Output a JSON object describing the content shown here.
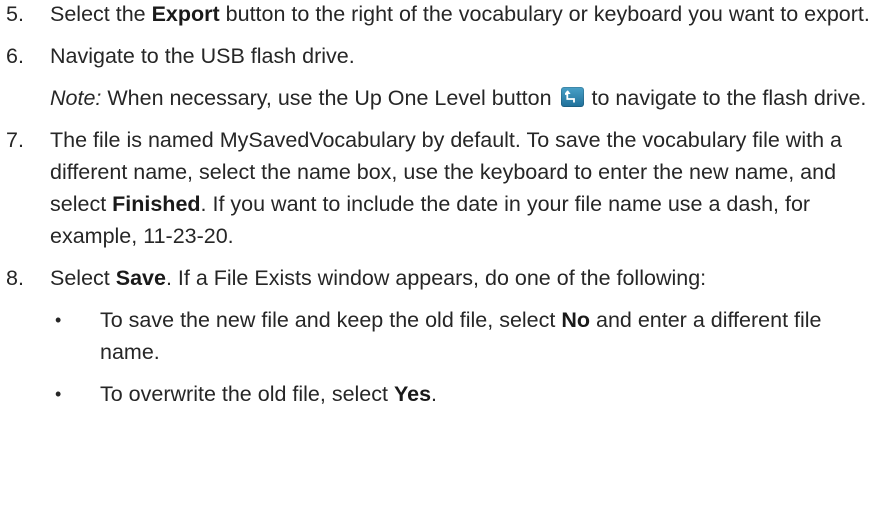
{
  "steps": [
    {
      "number": "5.",
      "t1": "Select the ",
      "b1": "Export",
      "t2": " button to the right of the vocabulary or keyboard you want to export."
    },
    {
      "number": "6.",
      "t1": "Navigate to the USB flash drive.",
      "note_label": "Note:",
      "note_t1": " When necessary, use the Up One Level button ",
      "note_t2": " to navigate to the flash drive.",
      "icon": "up-one-level-icon"
    },
    {
      "number": "7.",
      "t1": "The file is named MySavedVocabulary by default. To save the vocabulary file with a different name, select the name box, use the keyboard to enter the new name, and select ",
      "b1": "Finished",
      "t2": ". If you want to include the date in your file name use a dash, for example, 11-23-20."
    },
    {
      "number": "8.",
      "t1": "Select ",
      "b1": "Save",
      "t2": ". If a File Exists window appears, do one of the following:",
      "bullets": [
        {
          "symbol": "•",
          "t1": "To save the new file and keep the old file, select ",
          "b1": "No",
          "t2": " and enter a different file name."
        },
        {
          "symbol": "•",
          "t1": "To overwrite the old file, select ",
          "b1": "Yes",
          "t2": "."
        }
      ]
    }
  ],
  "colors": {
    "text": "#262626",
    "icon": "#2b85b3"
  }
}
